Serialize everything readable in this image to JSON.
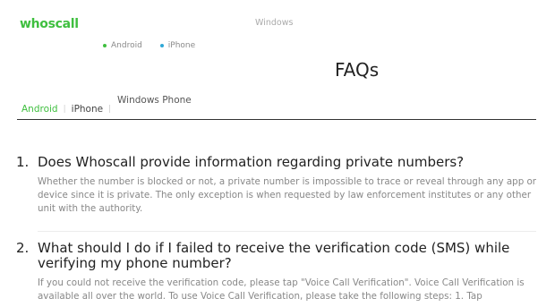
{
  "header": {
    "logo_text": "whoscall",
    "top_link": "Windows",
    "sub_nav": [
      {
        "label": "Android",
        "dot_color": "#3fbf3f"
      },
      {
        "label": "iPhone",
        "dot_color": "#2fa8d6"
      }
    ]
  },
  "page_title": "FAQs",
  "tabs": {
    "windows_phone": "Windows Phone",
    "android": "Android",
    "iphone": "iPhone",
    "separator": "|"
  },
  "faqs": [
    {
      "number": "1.",
      "question": "Does Whoscall provide information regarding private numbers?",
      "answer": "Whether the number is blocked or not, a private number is impossible to trace or reveal through any app or device since it is private. The only exception is when requested by law enforcement institutes or any other unit with the authority."
    },
    {
      "number": "2.",
      "question": "What should I do if I failed to receive the verification code (SMS) while verifying my phone number?",
      "answer": "If you could not receive the verification code, please tap \"Voice Call Verification\". Voice Call Verification is available all over the world. To use Voice Call Verification, please take the following steps: 1. Tap"
    }
  ],
  "colors": {
    "brand_green": "#3fbf3f",
    "iphone_blue": "#2fa8d6"
  }
}
